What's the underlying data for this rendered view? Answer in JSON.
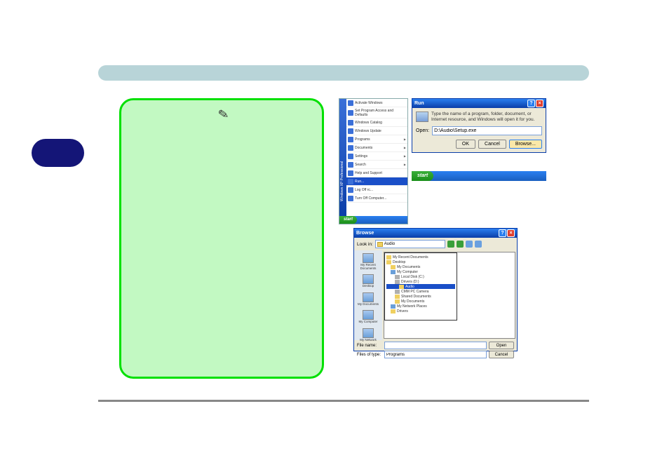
{
  "header": {
    "title": ""
  },
  "pill_label": "",
  "note": {
    "icon": "✎"
  },
  "startmenu": {
    "sidebar_text": "Windows XP Professional",
    "items": [
      {
        "label": "Activate Windows",
        "arrow": false
      },
      {
        "label": "Set Program Access and Defaults",
        "arrow": false
      },
      {
        "label": "Windows Catalog",
        "arrow": false
      },
      {
        "label": "Windows Update",
        "arrow": false
      },
      {
        "label": "Programs",
        "arrow": true
      },
      {
        "label": "Documents",
        "arrow": true
      },
      {
        "label": "Settings",
        "arrow": true
      },
      {
        "label": "Search",
        "arrow": true
      },
      {
        "label": "Help and Support",
        "arrow": false
      },
      {
        "label": "Run...",
        "arrow": false,
        "selected": true
      },
      {
        "label": "Log Off rc...",
        "arrow": false
      },
      {
        "label": "Turn Off Computer...",
        "arrow": false
      }
    ],
    "start_label": "start"
  },
  "run": {
    "title": "Run",
    "help": "?",
    "close": "×",
    "description": "Type the name of a program, folder, document, or Internet resource, and Windows will open it for you.",
    "open_label": "Open:",
    "open_value": "D:\\Audio\\Setup.exe",
    "ok": "OK",
    "cancel": "Cancel",
    "browse": "Browse...",
    "start_label": "start"
  },
  "browse": {
    "title": "Browse",
    "help": "?",
    "close": "×",
    "lookin_label": "Look in:",
    "lookin_value": "Audio",
    "places": [
      {
        "label": "My Recent Documents"
      },
      {
        "label": "Desktop"
      },
      {
        "label": "My Documents"
      },
      {
        "label": "My Computer"
      },
      {
        "label": "My Network"
      }
    ],
    "tree": [
      {
        "label": "My Recent Documents",
        "indent": 0,
        "icon": "folder"
      },
      {
        "label": "Desktop",
        "indent": 0,
        "icon": "folder"
      },
      {
        "label": "My Documents",
        "indent": 1,
        "icon": "folder"
      },
      {
        "label": "My Computer",
        "indent": 1,
        "icon": "comp"
      },
      {
        "label": "Local Disk (C:)",
        "indent": 2,
        "icon": "drive"
      },
      {
        "label": "Drivers (D:)",
        "indent": 2,
        "icon": "drive"
      },
      {
        "label": "Audio",
        "indent": 3,
        "icon": "folder",
        "selected": true
      },
      {
        "label": "CMM PC Camera",
        "indent": 2,
        "icon": "drive"
      },
      {
        "label": "Shared Documents",
        "indent": 2,
        "icon": "folder"
      },
      {
        "label": "My Documents",
        "indent": 2,
        "icon": "folder"
      },
      {
        "label": "My Network Places",
        "indent": 1,
        "icon": "comp"
      },
      {
        "label": "Drivers",
        "indent": 1,
        "icon": "folder"
      }
    ],
    "filename_label": "File name:",
    "filename_value": "",
    "filetype_label": "Files of type:",
    "filetype_value": "Programs",
    "open_btn": "Open",
    "cancel_btn": "Cancel"
  }
}
